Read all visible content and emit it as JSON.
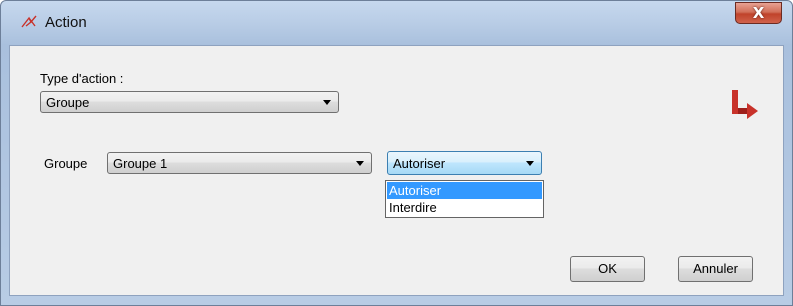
{
  "window": {
    "title": "Action",
    "close_symbol": "X"
  },
  "form": {
    "type_label": "Type d'action :",
    "type_value": "Groupe",
    "groupe_label": "Groupe",
    "groupe_value": "Groupe 1",
    "permission_value": "Autoriser",
    "permission_options": [
      "Autoriser",
      "Interdire"
    ],
    "selected_option_index": 0
  },
  "buttons": {
    "ok": "OK",
    "cancel": "Annuler"
  },
  "icons": {
    "app": "action-icon",
    "logo": "red-arrow-logo"
  },
  "colors": {
    "selection": "#3399ff",
    "logo": "#c8322a",
    "close": "#c0432b"
  }
}
